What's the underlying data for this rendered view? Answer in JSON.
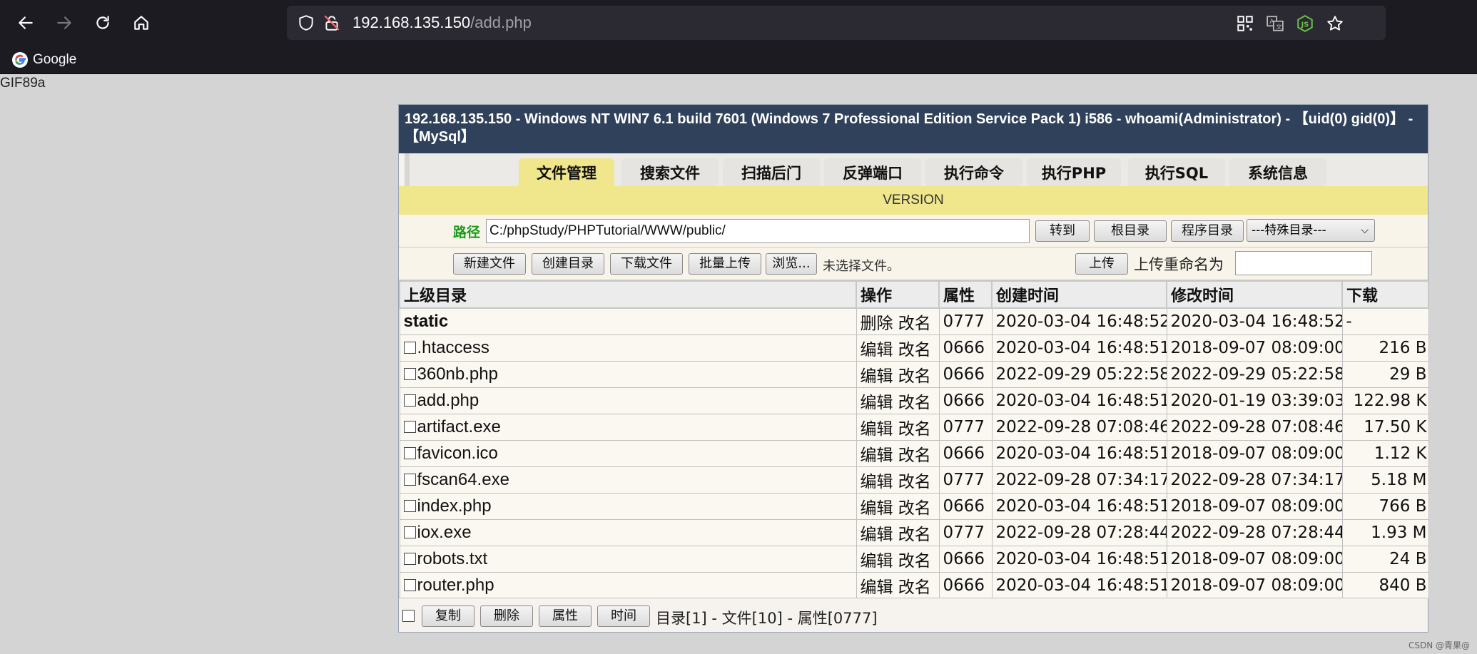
{
  "browser": {
    "url_host": "192.168.135.150",
    "url_path": "/add.php",
    "bookmark": "Google"
  },
  "gif_header": "GIF89a",
  "panel": {
    "header": "192.168.135.150 - Windows NT WIN7 6.1 build 7601 (Windows 7 Professional Edition Service Pack 1) i586 - whoami(Administrator) - 【uid(0) gid(0)】 - 【MySql】",
    "tabs": [
      "文件管理",
      "搜索文件",
      "扫描后门",
      "反弹端口",
      "执行命令",
      "执行PHP",
      "执行SQL",
      "系统信息"
    ],
    "version": "VERSION",
    "path_label": "路径",
    "path_value": "C:/phpStudy/PHPTutorial/WWW/public/",
    "goto": "转到",
    "root_dir": "根目录",
    "program_dir": "程序目录",
    "special_dir": "---特殊目录---",
    "new_file": "新建文件",
    "create_dir": "创建目录",
    "download_file": "下载文件",
    "batch_upload": "批量上传",
    "browse": "浏览...",
    "no_file": "未选择文件。",
    "upload": "上传",
    "rename_label": "上传重命名为"
  },
  "table": {
    "headers": [
      "上级目录",
      "操作",
      "属性",
      "创建时间",
      "修改时间",
      "下载"
    ],
    "dir_row": {
      "name": "static",
      "ops": "删除 改名",
      "attr": "0777",
      "created": "2020-03-04 16:48:52",
      "modified": "2020-03-04 16:48:52",
      "size": "-"
    },
    "rows": [
      {
        "name": ".htaccess",
        "ops": "编辑 改名",
        "attr": "0666",
        "created": "2020-03-04 16:48:51",
        "modified": "2018-09-07 08:09:00",
        "size": "216 B"
      },
      {
        "name": "360nb.php",
        "ops": "编辑 改名",
        "attr": "0666",
        "created": "2022-09-29 05:22:58",
        "modified": "2022-09-29 05:22:58",
        "size": "29 B"
      },
      {
        "name": "add.php",
        "ops": "编辑 改名",
        "attr": "0666",
        "created": "2020-03-04 16:48:51",
        "modified": "2020-01-19 03:39:03",
        "size": "122.98 K"
      },
      {
        "name": "artifact.exe",
        "ops": "编辑 改名",
        "attr": "0777",
        "created": "2022-09-28 07:08:46",
        "modified": "2022-09-28 07:08:46",
        "size": "17.50 K"
      },
      {
        "name": "favicon.ico",
        "ops": "编辑 改名",
        "attr": "0666",
        "created": "2020-03-04 16:48:51",
        "modified": "2018-09-07 08:09:00",
        "size": "1.12 K"
      },
      {
        "name": "fscan64.exe",
        "ops": "编辑 改名",
        "attr": "0777",
        "created": "2022-09-28 07:34:17",
        "modified": "2022-09-28 07:34:17",
        "size": "5.18 M"
      },
      {
        "name": "index.php",
        "ops": "编辑 改名",
        "attr": "0666",
        "created": "2020-03-04 16:48:51",
        "modified": "2018-09-07 08:09:00",
        "size": "766 B"
      },
      {
        "name": "iox.exe",
        "ops": "编辑 改名",
        "attr": "0777",
        "created": "2022-09-28 07:28:44",
        "modified": "2022-09-28 07:28:44",
        "size": "1.93 M"
      },
      {
        "name": "robots.txt",
        "ops": "编辑 改名",
        "attr": "0666",
        "created": "2020-03-04 16:48:51",
        "modified": "2018-09-07 08:09:00",
        "size": "24 B"
      },
      {
        "name": "router.php",
        "ops": "编辑 改名",
        "attr": "0666",
        "created": "2020-03-04 16:48:51",
        "modified": "2018-09-07 08:09:00",
        "size": "840 B"
      }
    ]
  },
  "footer": {
    "copy": "复制",
    "delete": "删除",
    "attr": "属性",
    "time": "时间",
    "summary": "目录[1] - 文件[10] - 属性[0777]"
  },
  "watermark": "CSDN @青果@"
}
